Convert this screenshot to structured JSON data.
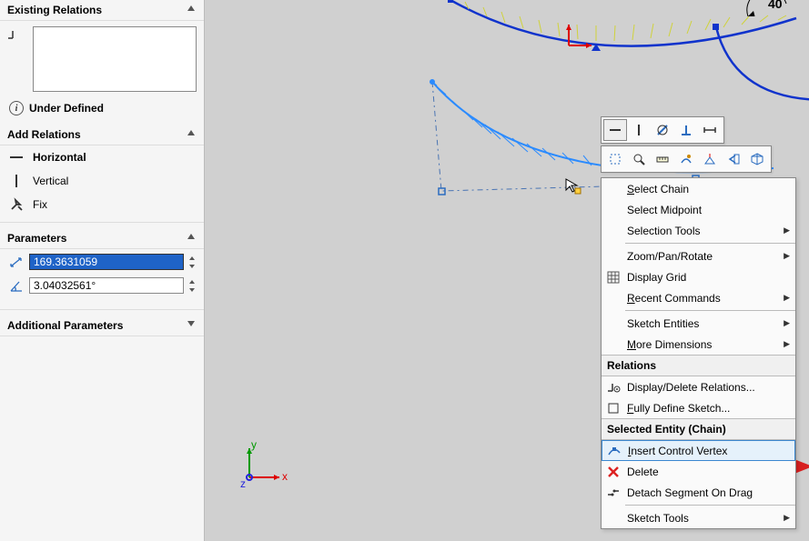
{
  "left_panel": {
    "existing_relations": {
      "title": "Existing Relations",
      "status": "Under Defined"
    },
    "add_relations": {
      "title": "Add Relations",
      "items": [
        {
          "label": "Horizontal",
          "bold": true,
          "icon": "horizontal"
        },
        {
          "label": "Vertical",
          "bold": false,
          "icon": "vertical"
        },
        {
          "label": "Fix",
          "bold": false,
          "icon": "fix"
        }
      ]
    },
    "parameters": {
      "title": "Parameters",
      "length_value": "169.3631059",
      "angle_value": "3.04032561°"
    },
    "additional_parameters": {
      "title": "Additional Parameters"
    }
  },
  "angle_dim": "40",
  "context_menu": {
    "row1_icons": [
      "line",
      "vertical-line",
      "tangent",
      "perp",
      "horiz"
    ],
    "row2_icons": [
      "construction",
      "zoom",
      "measure",
      "eyedrop",
      "normal-to",
      "arrow-left",
      "view3d"
    ],
    "group1": [
      {
        "label": "Select Chain",
        "icon": null
      },
      {
        "label": "Select Midpoint",
        "icon": null
      },
      {
        "label": "Selection Tools",
        "icon": null,
        "submenu": true
      }
    ],
    "group2": [
      {
        "label": "Zoom/Pan/Rotate",
        "icon": null,
        "submenu": true
      },
      {
        "label": "Display Grid",
        "icon": "grid"
      },
      {
        "label": "Recent Commands",
        "icon": null,
        "submenu": true
      }
    ],
    "group3": [
      {
        "label": "Sketch Entities",
        "icon": null,
        "submenu": true
      },
      {
        "label": "More Dimensions",
        "icon": null,
        "submenu": true
      }
    ],
    "relations_header": "Relations",
    "group4": [
      {
        "label": "Display/Delete Relations...",
        "icon": "display-relations"
      },
      {
        "label": "Fully Define Sketch...",
        "icon": "fully-define"
      }
    ],
    "selected_header": "Selected Entity (Chain)",
    "group5": [
      {
        "label": "Insert Control Vertex",
        "icon": "insert-vertex",
        "highlight": true
      },
      {
        "label": "Delete",
        "icon": "delete"
      },
      {
        "label": "Detach Segment On Drag",
        "icon": "detach"
      }
    ],
    "group6": [
      {
        "label": "Sketch Tools",
        "icon": null,
        "submenu": true
      }
    ]
  }
}
